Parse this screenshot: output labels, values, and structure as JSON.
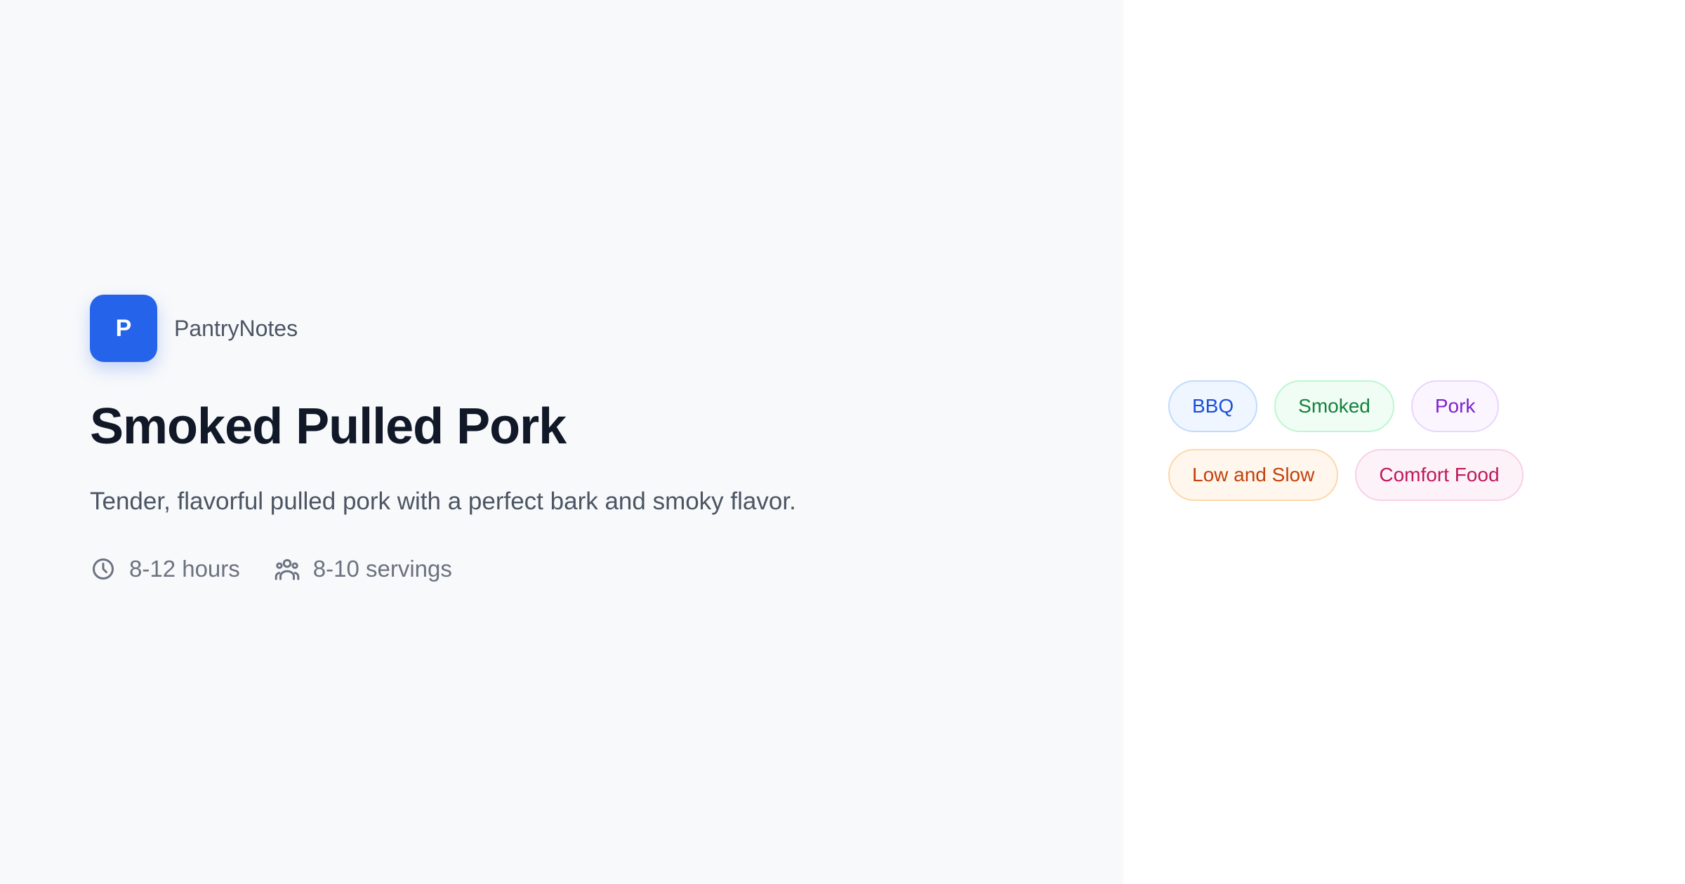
{
  "brand": {
    "logo_letter": "P",
    "name": "PantryNotes"
  },
  "recipe": {
    "title": "Smoked Pulled Pork",
    "description": "Tender, flavorful pulled pork with a perfect bark and smoky flavor.",
    "time": "8-12 hours",
    "servings": "8-10 servings"
  },
  "tags": [
    {
      "label": "BBQ"
    },
    {
      "label": "Smoked"
    },
    {
      "label": "Pork"
    },
    {
      "label": "Low and Slow"
    },
    {
      "label": "Comfort Food"
    }
  ],
  "icons": {
    "time": "clock-icon",
    "servings": "users-icon"
  },
  "colors": {
    "accent": "#2563eb",
    "title": "#111827",
    "text_secondary": "#4b5563",
    "meta": "#6b7280",
    "left_background": "#f8f9fb",
    "right_background": "#ffffff"
  }
}
